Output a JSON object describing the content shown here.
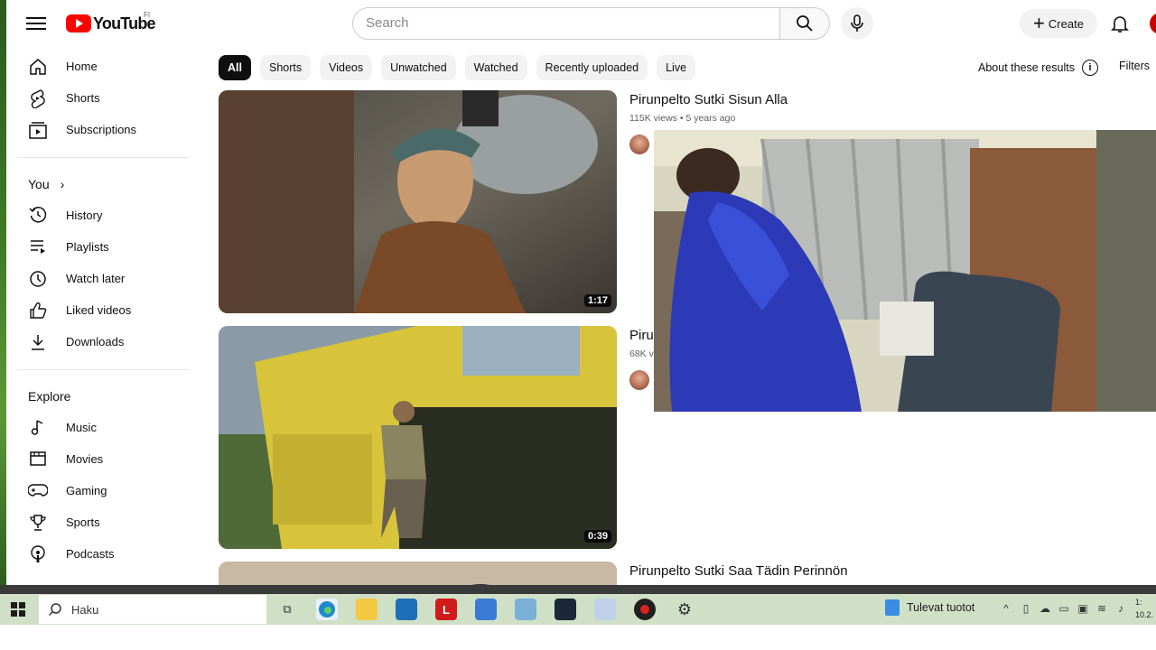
{
  "header": {
    "logo_text": "YouTube",
    "region": "FI",
    "search_placeholder": "Search",
    "create_label": "Create"
  },
  "sidebar": {
    "main": [
      {
        "label": "Home",
        "icon": "home-icon"
      },
      {
        "label": "Shorts",
        "icon": "shorts-icon"
      },
      {
        "label": "Subscriptions",
        "icon": "subscriptions-icon"
      }
    ],
    "you_title": "You",
    "you": [
      {
        "label": "History",
        "icon": "history-icon"
      },
      {
        "label": "Playlists",
        "icon": "playlists-icon"
      },
      {
        "label": "Watch later",
        "icon": "watch-later-icon"
      },
      {
        "label": "Liked videos",
        "icon": "like-icon"
      },
      {
        "label": "Downloads",
        "icon": "download-icon"
      }
    ],
    "explore_title": "Explore",
    "explore": [
      {
        "label": "Music",
        "icon": "music-icon"
      },
      {
        "label": "Movies",
        "icon": "movies-icon"
      },
      {
        "label": "Gaming",
        "icon": "gaming-icon"
      },
      {
        "label": "Sports",
        "icon": "trophy-icon"
      },
      {
        "label": "Podcasts",
        "icon": "podcasts-icon"
      }
    ]
  },
  "chips": [
    "All",
    "Shorts",
    "Videos",
    "Unwatched",
    "Watched",
    "Recently uploaded",
    "Live"
  ],
  "active_chip": "All",
  "about_label": "About these results",
  "filters_label": "Filters",
  "results": [
    {
      "title": "Pirunpelto Sutki Sisun Alla",
      "views": "115K views",
      "age": "5 years ago",
      "duration": "1:17"
    },
    {
      "title": "Pirun",
      "views": "68K v",
      "age": "",
      "duration": "0:39"
    },
    {
      "title": "Pirunpelto Sutki Saa Tädin Perinnön",
      "views": "",
      "age": "",
      "duration": ""
    }
  ],
  "taskbar": {
    "search_placeholder": "Haku",
    "news_label": "Tulevat tuotot",
    "clock_time": "1:",
    "clock_date": "10.2."
  },
  "colors": {
    "youtube_red": "#ff0000",
    "chip_bg": "#f2f2f2",
    "chip_active_bg": "#0f0f0f",
    "taskbar_bg": "#cfe0c7"
  }
}
